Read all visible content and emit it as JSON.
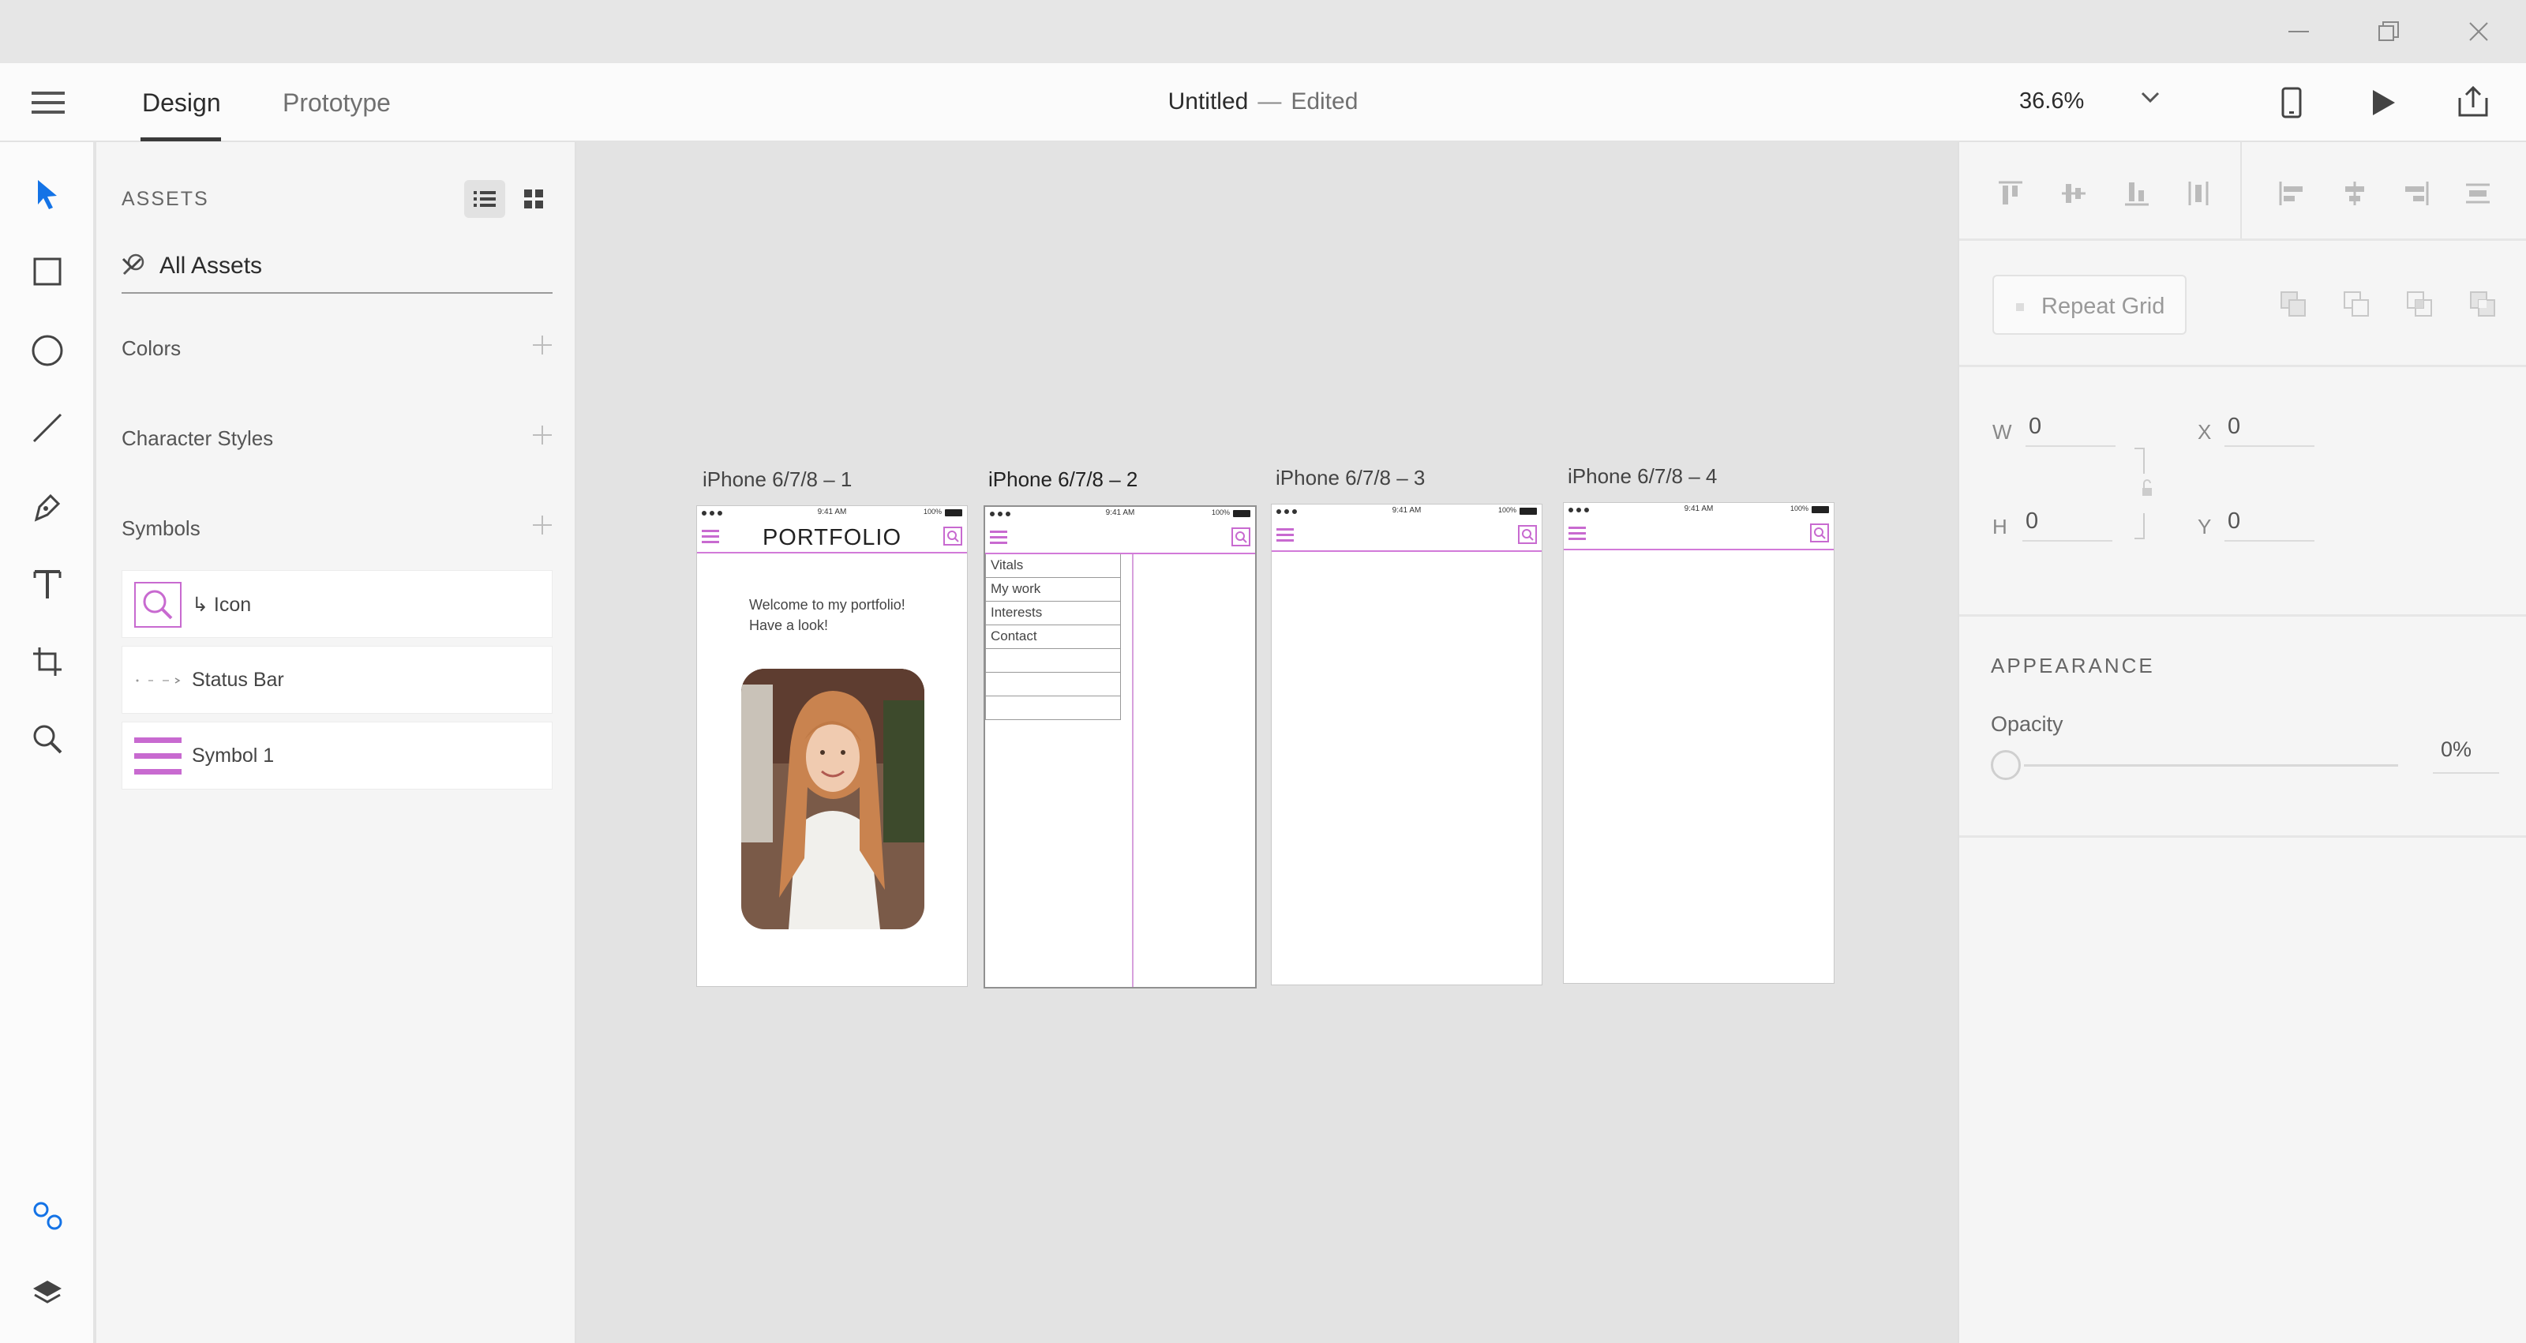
{
  "window": {
    "controls": [
      "minimize",
      "restore",
      "close"
    ]
  },
  "header": {
    "tabs": [
      "Design",
      "Prototype"
    ],
    "document_name": "Untitled",
    "separator": "—",
    "document_status": "Edited",
    "zoom": "36.6%"
  },
  "toolbar": {
    "tools": [
      "select-tool",
      "rectangle-tool",
      "ellipse-tool",
      "line-tool",
      "pen-tool",
      "text-tool",
      "artboard-tool",
      "zoom-tool"
    ],
    "bottom": [
      "assets-panel",
      "layers-panel"
    ]
  },
  "assets": {
    "title": "ASSETS",
    "filter": "All Assets",
    "sections": {
      "colors": "Colors",
      "character_styles": "Character Styles",
      "symbols": "Symbols"
    },
    "symbols": [
      {
        "label": "↳ Icon"
      },
      {
        "label": "Status Bar"
      },
      {
        "label": "Symbol 1"
      }
    ]
  },
  "canvas": {
    "artboards": [
      {
        "title": "iPhone 6/7/8 – 1",
        "heading": "PORTFOLIO",
        "welcome_line1": "Welcome to my portfolio!",
        "welcome_line2": "Have a look!"
      },
      {
        "title": "iPhone 6/7/8 – 2",
        "menu": [
          "Vitals",
          "My work",
          "Interests",
          "Contact",
          "",
          "",
          ""
        ]
      },
      {
        "title": "iPhone 6/7/8 – 3"
      },
      {
        "title": "iPhone 6/7/8 – 4"
      }
    ],
    "status_bar": {
      "time": "9:41 AM",
      "battery": "100%"
    }
  },
  "properties": {
    "repeat_grid": "Repeat Grid",
    "w_label": "W",
    "w_value": "0",
    "h_label": "H",
    "h_value": "0",
    "x_label": "X",
    "x_value": "0",
    "y_label": "Y",
    "y_value": "0",
    "appearance": "APPEARANCE",
    "opacity_label": "Opacity",
    "opacity_value": "0%",
    "opacity_level": 0
  },
  "colors": {
    "accent": "#1473e6",
    "symbol_purple": "#c86ad0",
    "canvas": "#e3e3e3"
  }
}
